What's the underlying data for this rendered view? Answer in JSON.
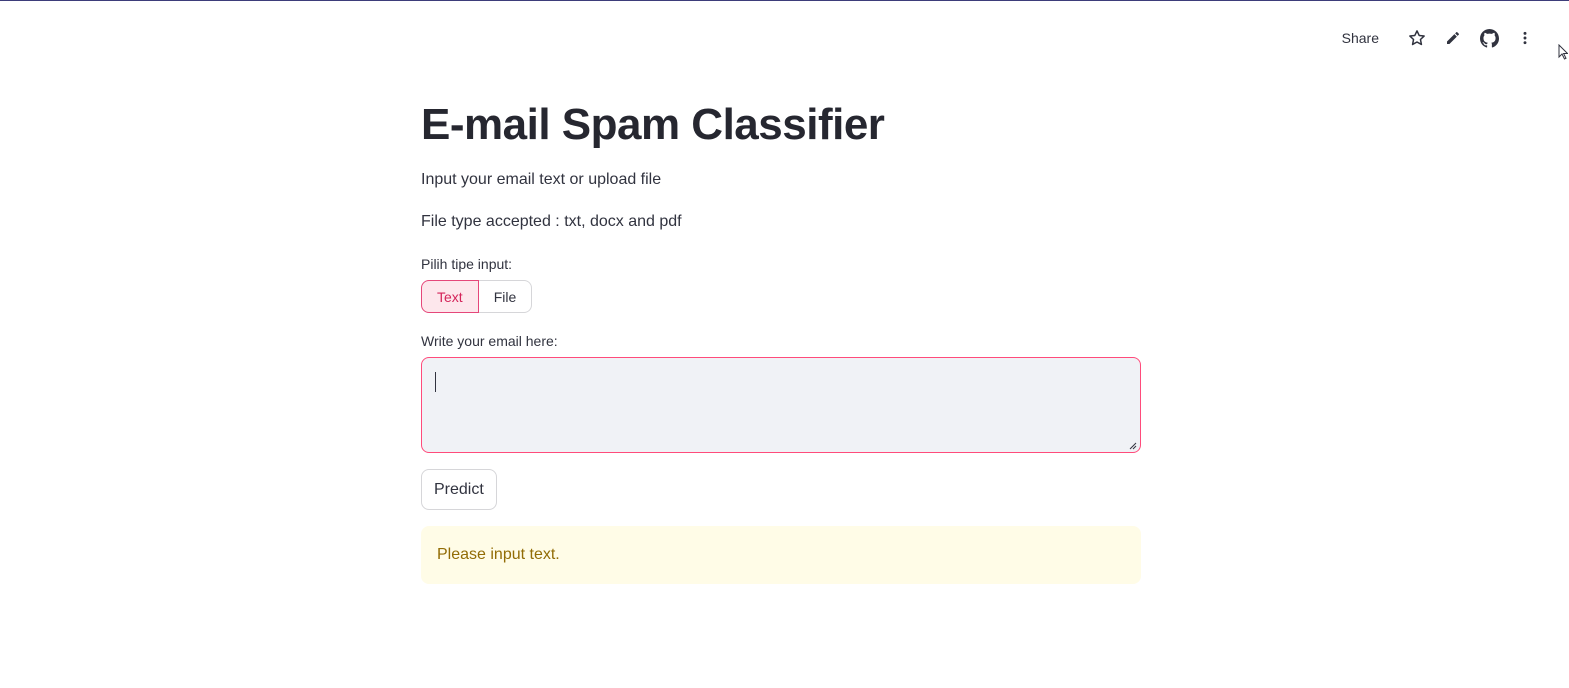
{
  "toolbar": {
    "share_label": "Share",
    "icons": [
      "star-icon",
      "pencil-icon",
      "github-icon",
      "more-vertical-icon"
    ]
  },
  "main": {
    "title": "E-mail Spam Classifier",
    "description_1": "Input your email text or upload file",
    "description_2": "File type accepted : txt, docx and pdf",
    "input_type": {
      "label": "Pilih tipe input:",
      "options": [
        "Text",
        "File"
      ],
      "selected": "Text"
    },
    "email_field": {
      "label": "Write your email here:",
      "value": ""
    },
    "predict_label": "Predict",
    "warning_text": "Please input text."
  },
  "colors": {
    "accent": "#ff4b7b",
    "title": "#262730",
    "text": "#31333f",
    "textarea_bg": "#f0f2f6",
    "warning_bg": "#fffce7",
    "warning_text": "#926c05"
  }
}
